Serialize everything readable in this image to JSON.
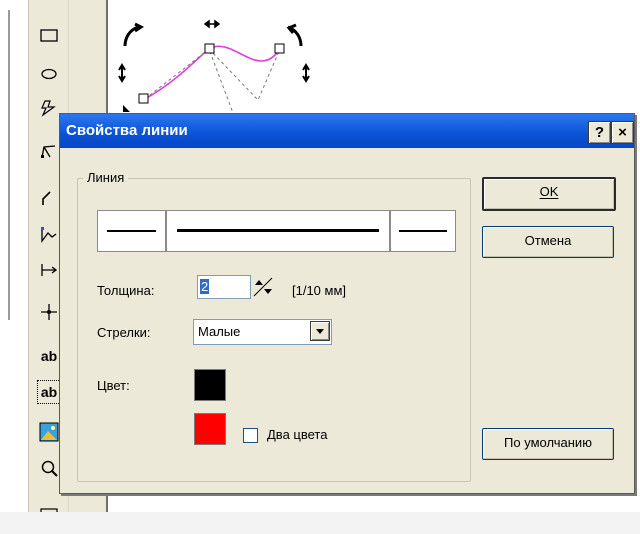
{
  "dialog": {
    "title": "Свойства линии",
    "help_label": "?",
    "close_label": "×",
    "group_label": "Линия",
    "thickness_label": "Толщина:",
    "thickness_value": "2",
    "thickness_unit": "[1/10 мм]",
    "arrows_label": "Стрелки:",
    "arrows_value": "Малые",
    "color_label": "Цвет:",
    "primary_color": "#000000",
    "secondary_color": "#ff0000",
    "two_colors_label": "Два цвета",
    "two_colors_checked": false,
    "ok_label": "OK",
    "cancel_label": "Отмена",
    "default_label": "По умолчанию"
  },
  "toolbar": {
    "tools": [
      "rectangle-tool",
      "ellipse-tool",
      "polygon-tool",
      "polyline-tool",
      "line-tool",
      "curve-tool",
      "dimension-tool",
      "point-tool",
      "text-tool",
      "textbox-tool",
      "image-tool",
      "zoom-tool"
    ],
    "text_tool_label": "ab",
    "textbox_tool_label": "ab"
  },
  "canvas": {
    "curve_color": "#e040e0"
  }
}
